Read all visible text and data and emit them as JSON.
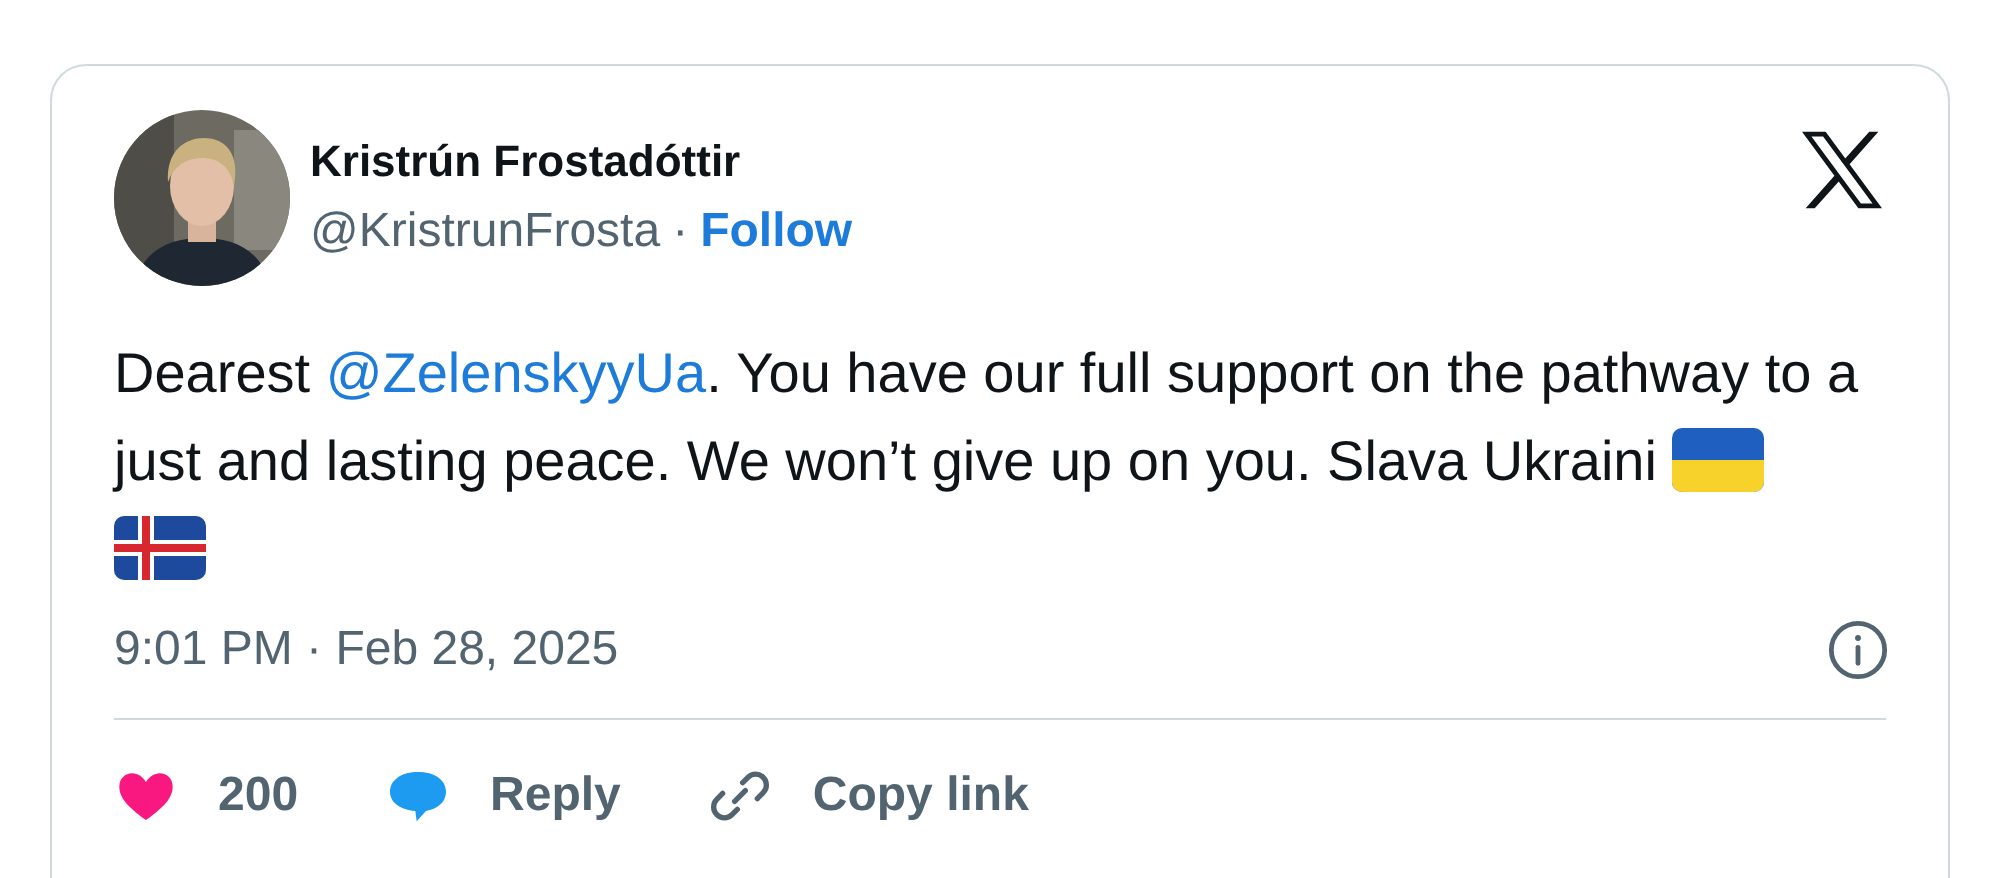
{
  "author": {
    "name": "Kristrún Frostadóttir",
    "handle": "@KristrunFrosta",
    "separator": "·",
    "follow": "Follow"
  },
  "body": [
    {
      "kind": "text",
      "text": "Dearest "
    },
    {
      "kind": "mention",
      "text": "@ZelenskyyUa"
    },
    {
      "kind": "text",
      "text": ". You have our full support on the pathway to a just and lasting peace. We won’t give up on you. Slava Ukraini "
    }
  ],
  "timestamp": "9:01 PM · Feb 28, 2025",
  "actions": [
    {
      "kind": "like",
      "label": "200"
    },
    {
      "kind": "reply",
      "label": "Reply"
    },
    {
      "kind": "copy",
      "label": "Copy link"
    }
  ]
}
